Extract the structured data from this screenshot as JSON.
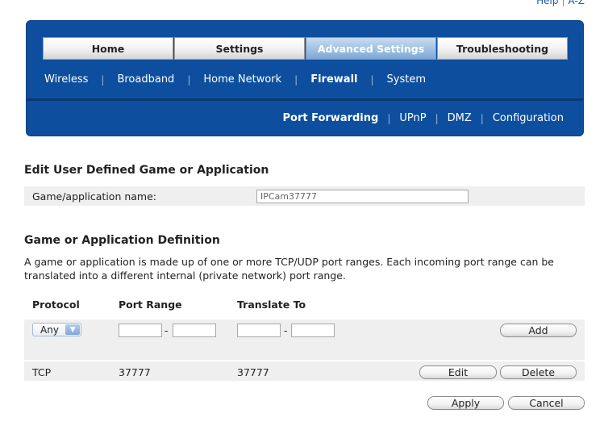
{
  "top_links": {
    "help": "Help",
    "sep": "|",
    "a_z": "A-Z"
  },
  "main_tabs": [
    {
      "label": "Home"
    },
    {
      "label": "Settings"
    },
    {
      "label": "Advanced Settings"
    },
    {
      "label": "Troubleshooting"
    }
  ],
  "sub_nav": [
    {
      "label": "Wireless"
    },
    {
      "label": "Broadband"
    },
    {
      "label": "Home Network"
    },
    {
      "label": "Firewall"
    },
    {
      "label": "System"
    }
  ],
  "subsub_nav": [
    {
      "label": "Port Forwarding"
    },
    {
      "label": "UPnP"
    },
    {
      "label": "DMZ"
    },
    {
      "label": "Configuration"
    }
  ],
  "separator": "|",
  "edit_section": {
    "title": "Edit User Defined Game or Application",
    "name_label": "Game/application name:",
    "name_value": "IPCam37777"
  },
  "definition_section": {
    "title": "Game or Application Definition",
    "description": "A game or application is made up of one or more TCP/UDP port ranges. Each incoming port range can be translated into a different internal (private network) port range."
  },
  "table": {
    "headers": {
      "protocol": "Protocol",
      "port_range": "Port Range",
      "translate_to": "Translate To"
    },
    "new_row": {
      "protocol_selected": "Any",
      "dash": "-",
      "add_label": "Add"
    },
    "rows": [
      {
        "protocol": "TCP",
        "port_range": "37777",
        "translate_to": "37777",
        "edit_label": "Edit",
        "delete_label": "Delete"
      }
    ]
  },
  "actions": {
    "apply": "Apply",
    "cancel": "Cancel"
  }
}
